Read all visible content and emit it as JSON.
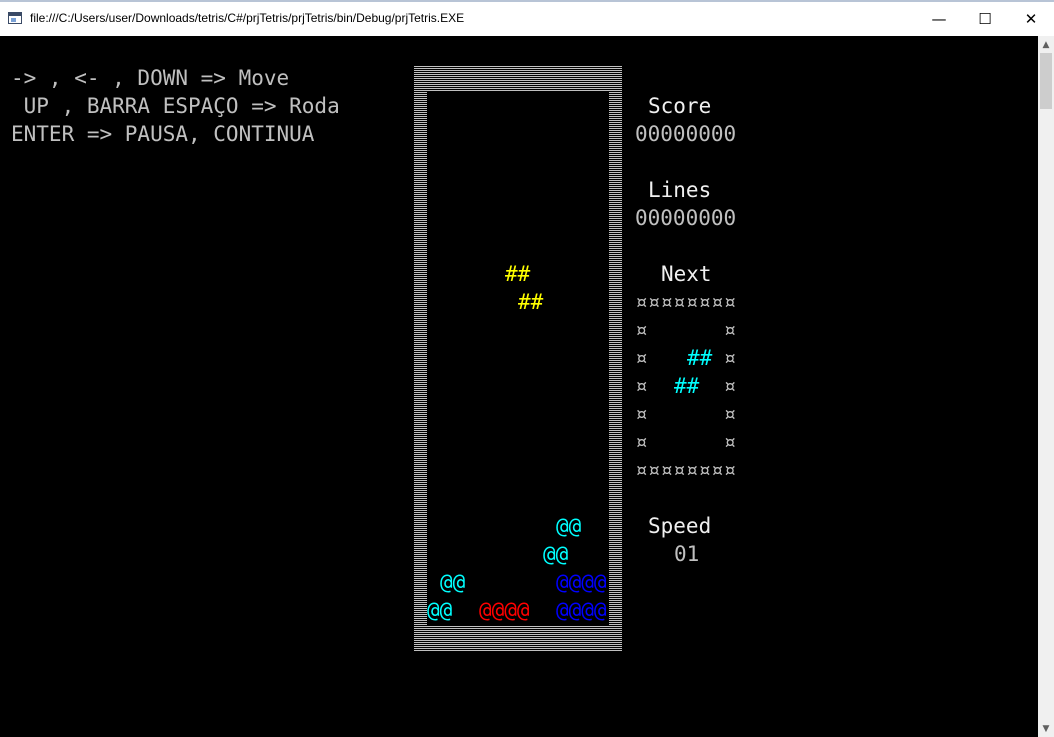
{
  "window": {
    "title": "file:///C:/Users/user/Downloads/tetris/C#/prjTetris/prjTetris/bin/Debug/prjTetris.EXE",
    "min_glyph": "—",
    "max_glyph": "☐",
    "close_glyph": "✕"
  },
  "instructions": {
    "line1": "-> , <- , DOWN => Move",
    "line2": " UP , BARRA ESPAÇO => Roda",
    "line3": "ENTER => PAUSA, CONTINUA"
  },
  "score": {
    "label": "Score",
    "value": "00000000"
  },
  "lines": {
    "label": "Lines",
    "value": "00000000"
  },
  "next": {
    "label": "Next",
    "rows": [
      "¤¤¤¤¤¤¤¤",
      "¤      ¤",
      "¤      ¤",
      "¤      ¤",
      "¤      ¤",
      "¤      ¤",
      "¤¤¤¤¤¤¤¤"
    ],
    "piece_row1": "##",
    "piece_row2": "##"
  },
  "speed": {
    "label": "Speed",
    "value": "01"
  },
  "board": {
    "falling_row1": "##",
    "falling_row2": "##",
    "settled": {
      "c1": "@@",
      "c2": "@@",
      "c3": "@@",
      "c4": "@@",
      "red": "@@@@",
      "blue1": "@@@@",
      "blue2": "@@@@"
    }
  },
  "colors": {
    "background": "#000000",
    "text": "#c0c0c0",
    "falling": "#ffff00",
    "next_piece": "#00ffff",
    "cyan_blocks": "#00ffff",
    "red_blocks": "#ff0000",
    "blue_blocks": "#0000ff"
  }
}
